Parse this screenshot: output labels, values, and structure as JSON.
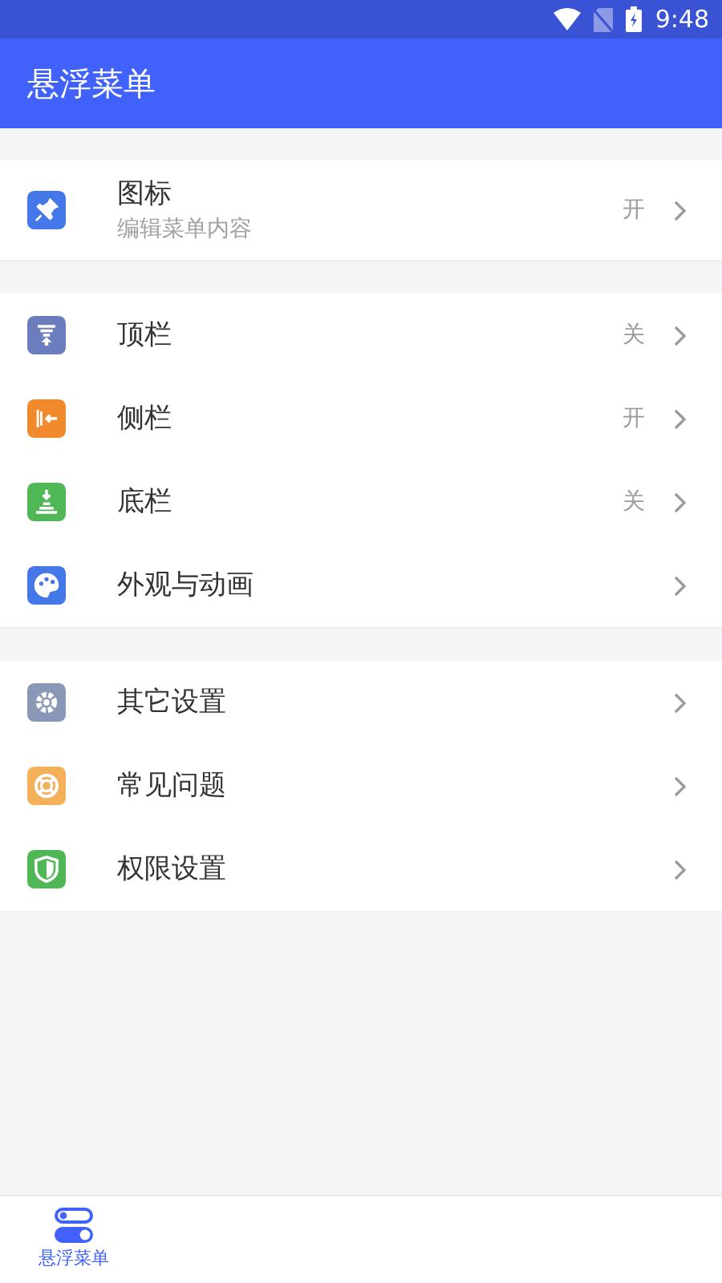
{
  "status_bar": {
    "time": "9:48"
  },
  "app_bar": {
    "title": "悬浮菜单"
  },
  "groups": [
    {
      "items": [
        {
          "title": "图标",
          "subtitle": "编辑菜单内容",
          "value": "开",
          "color": "#4477e8"
        }
      ]
    },
    {
      "items": [
        {
          "title": "顶栏",
          "value": "关",
          "color": "#6b7dbd"
        },
        {
          "title": "侧栏",
          "value": "开",
          "color": "#f08a2c"
        },
        {
          "title": "底栏",
          "value": "关",
          "color": "#4fb756"
        },
        {
          "title": "外观与动画",
          "color": "#4477e8"
        }
      ]
    },
    {
      "items": [
        {
          "title": "其它设置",
          "color": "#8a98b8"
        },
        {
          "title": "常见问题",
          "color": "#f5b05a"
        },
        {
          "title": "权限设置",
          "color": "#4fb756"
        }
      ]
    }
  ],
  "bottom_nav": [
    {
      "label": "悬浮菜单",
      "selected": true
    }
  ]
}
